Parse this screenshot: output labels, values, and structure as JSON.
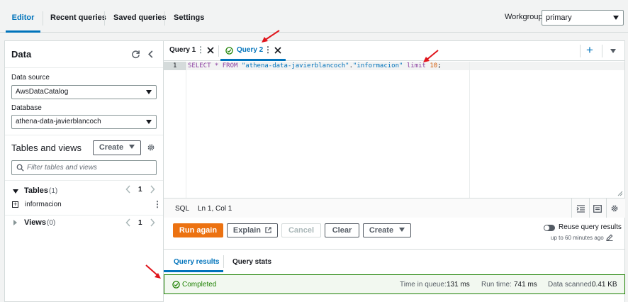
{
  "top_tabs": [
    "Editor",
    "Recent queries",
    "Saved queries",
    "Settings"
  ],
  "workgroup": {
    "label": "Workgroup",
    "value": "primary"
  },
  "left": {
    "title": "Data",
    "data_source_label": "Data source",
    "data_source_value": "AwsDataCatalog",
    "database_label": "Database",
    "database_value": "athena-data-javierblancoch",
    "tables_views_title": "Tables and views",
    "create_label": "Create",
    "filter_placeholder": "Filter tables and views",
    "tables_label": "Tables",
    "tables_count": "(1)",
    "tables_page": "1",
    "table_item": "informacion",
    "views_label": "Views",
    "views_count": "(0)",
    "views_page": "1"
  },
  "query_tabs": [
    {
      "label": "Query 1"
    },
    {
      "label": "Query 2"
    }
  ],
  "editor": {
    "line_number": "1",
    "code_parts": [
      "SELECT * FROM ",
      "\"athena-data-javierblancoch\"",
      ".",
      "\"informacion\"",
      " limit ",
      "10",
      ";"
    ],
    "status_lang": "SQL",
    "status_pos": "Ln 1, Col 1"
  },
  "actions": {
    "run": "Run again",
    "explain": "Explain",
    "cancel": "Cancel",
    "clear": "Clear",
    "create": "Create",
    "reuse_label": "Reuse query results",
    "reuse_sub": "up to 60 minutes ago"
  },
  "results": {
    "tabs": [
      "Query results",
      "Query stats"
    ],
    "status": "Completed",
    "time_in_queue_label": "Time in queue:",
    "time_in_queue": "131 ms",
    "run_time_label": "Run time:",
    "run_time": "741 ms",
    "data_scanned_label": "Data scanned:",
    "data_scanned": "0.41 KB"
  },
  "colors": {
    "accent": "#0073bb",
    "primary_button": "#ec7211",
    "success": "#1d8102",
    "annotation_arrow": "#e0141b"
  }
}
